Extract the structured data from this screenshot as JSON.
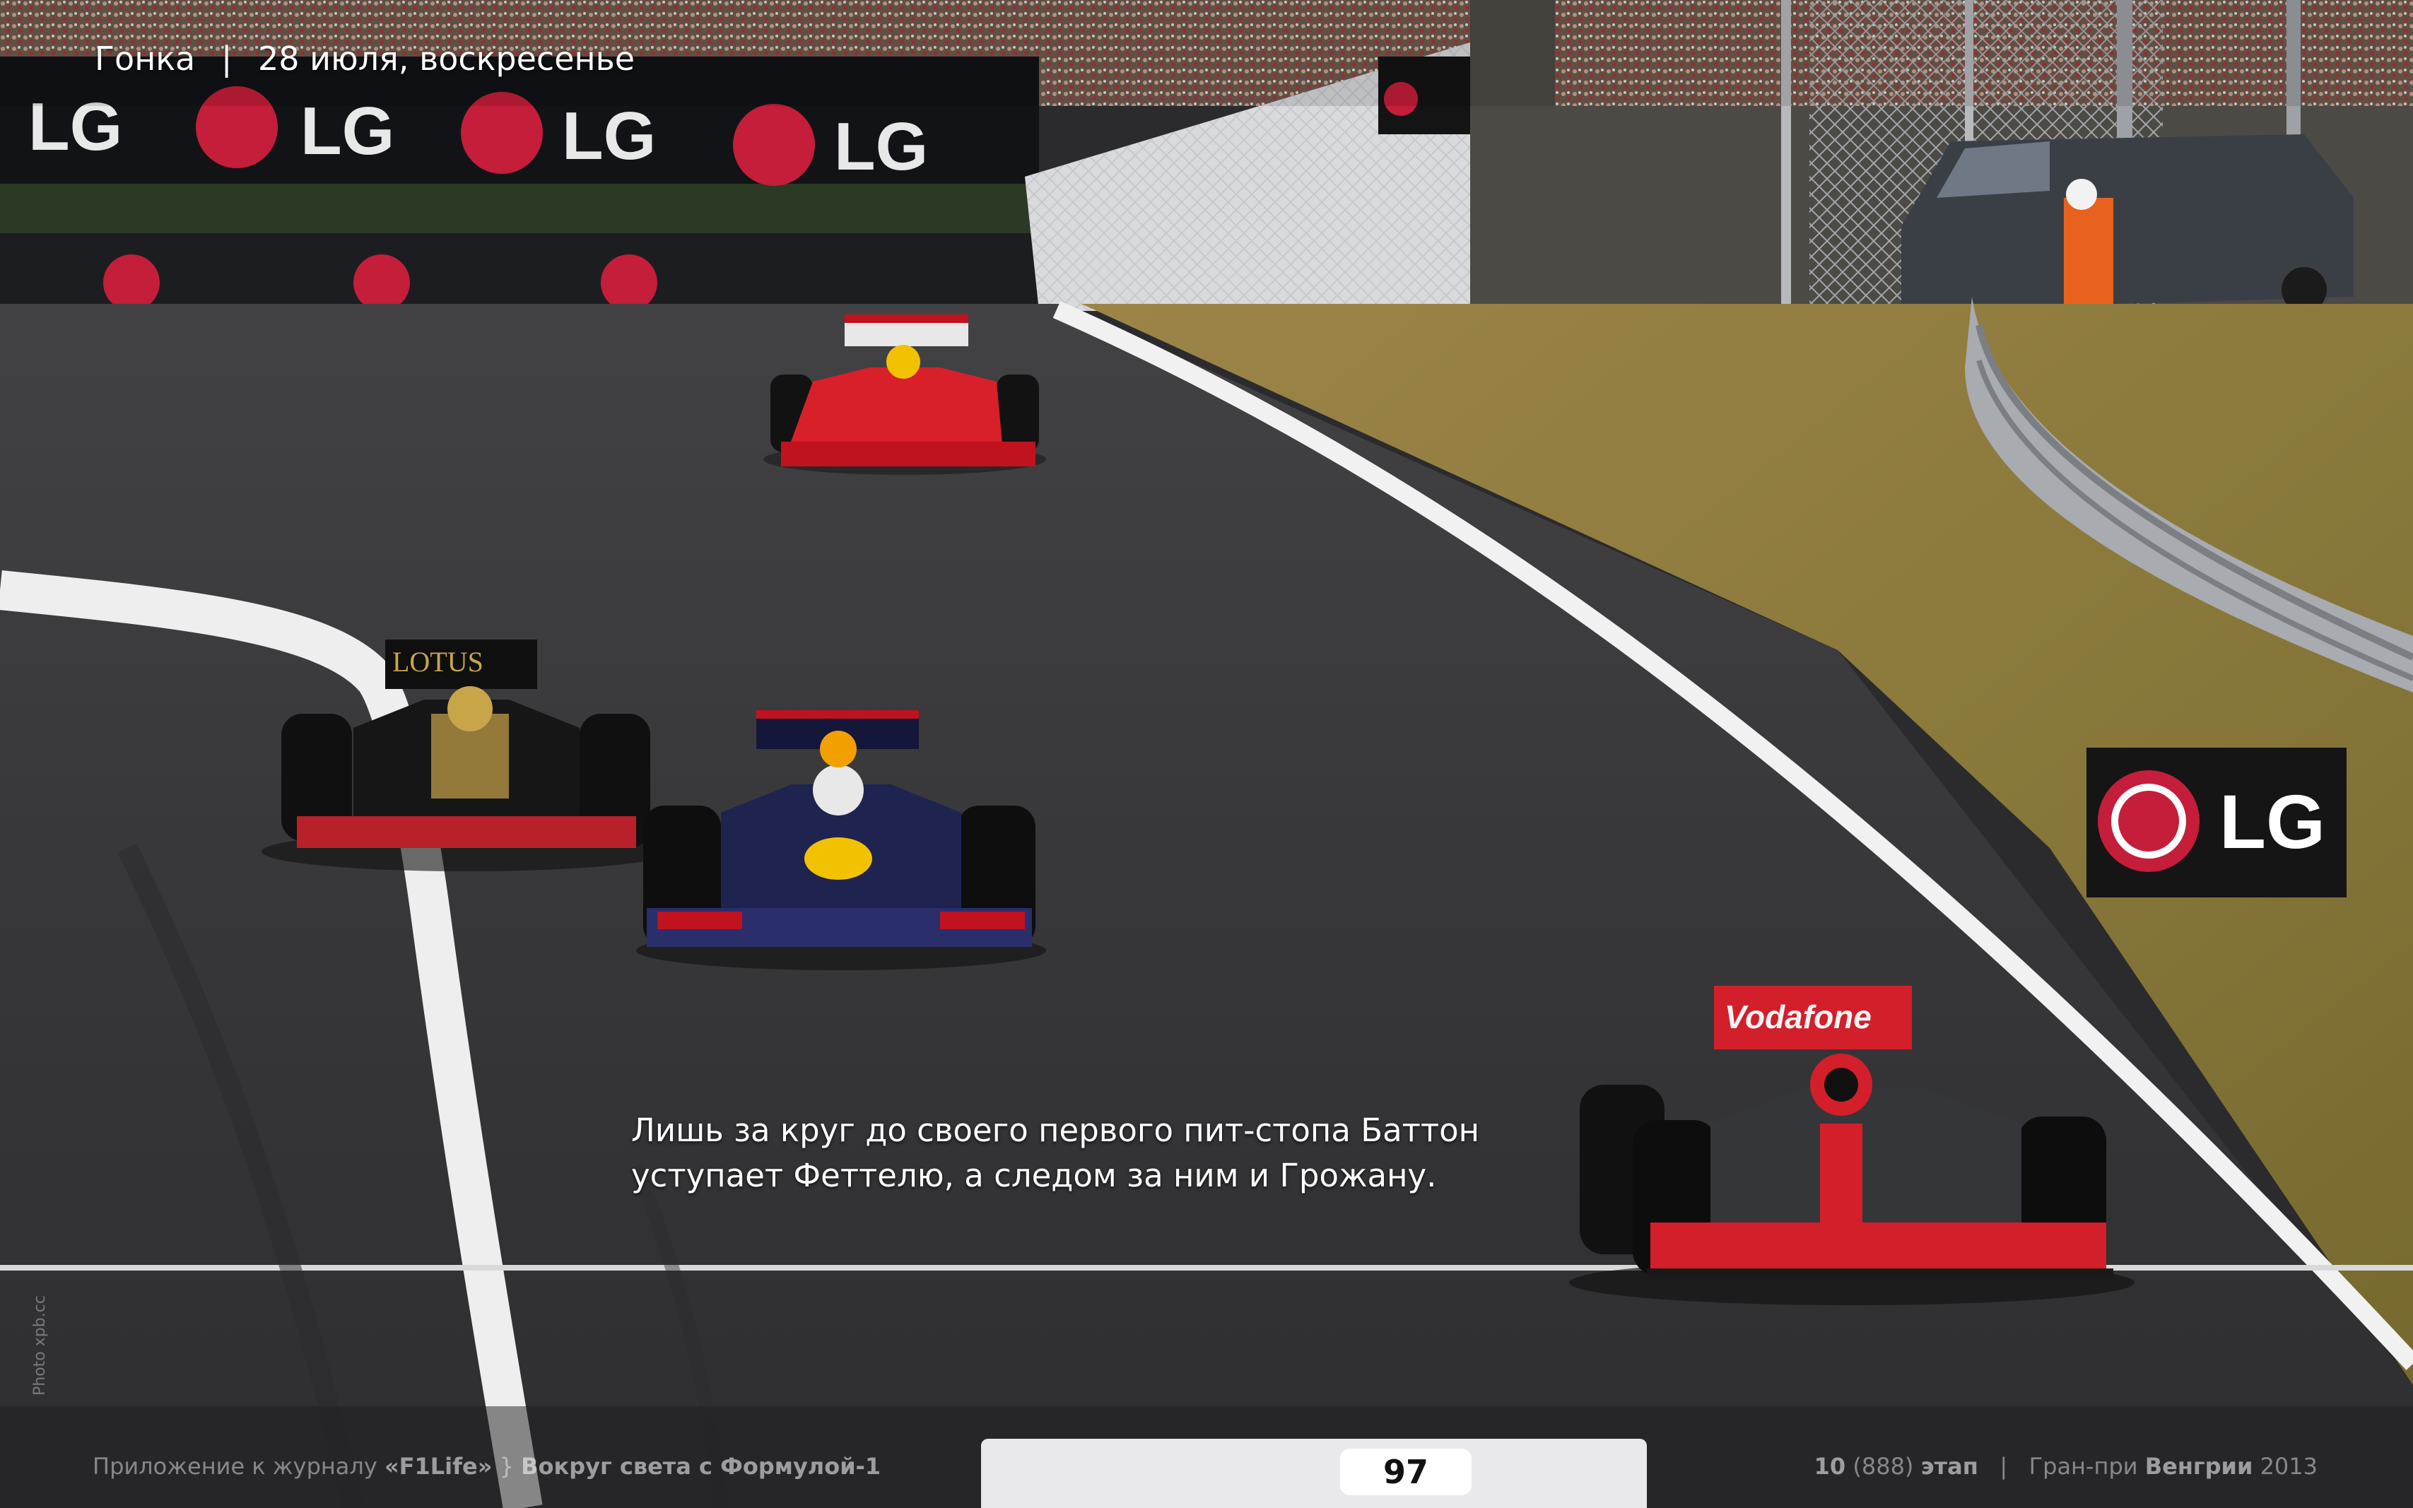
{
  "header": {
    "section": "Гонка",
    "separator": "|",
    "date": "28 июля, воскресенье"
  },
  "caption": {
    "line1": "Лишь за круг до своего первого пит-стопа Баттон",
    "line2": "уступает Феттелю, а следом за ним и Грожану."
  },
  "credit": "Photo xpb.cc",
  "footer": {
    "left_prefix": "Приложение к журналу",
    "magazine": "«F1Life»",
    "divider": "}",
    "series": "Вокруг света с Формулой-1",
    "page_number": "97",
    "issue_number": "10",
    "issue_total": "(888)",
    "stage_word": "этап",
    "bar": "|",
    "gp_prefix": "Гран-при",
    "gp_country": "Венгрии",
    "year": "2013"
  },
  "signs": {
    "brand": "LG",
    "team_lotus": "LOTUS"
  },
  "colors": {
    "track": "#3a3a3c",
    "grass": "#8a7a3f",
    "ferrari": "#d8202a",
    "lotus": "#c9a54a",
    "redbull": "#1f2350",
    "mclaren": "#d31f2a"
  }
}
